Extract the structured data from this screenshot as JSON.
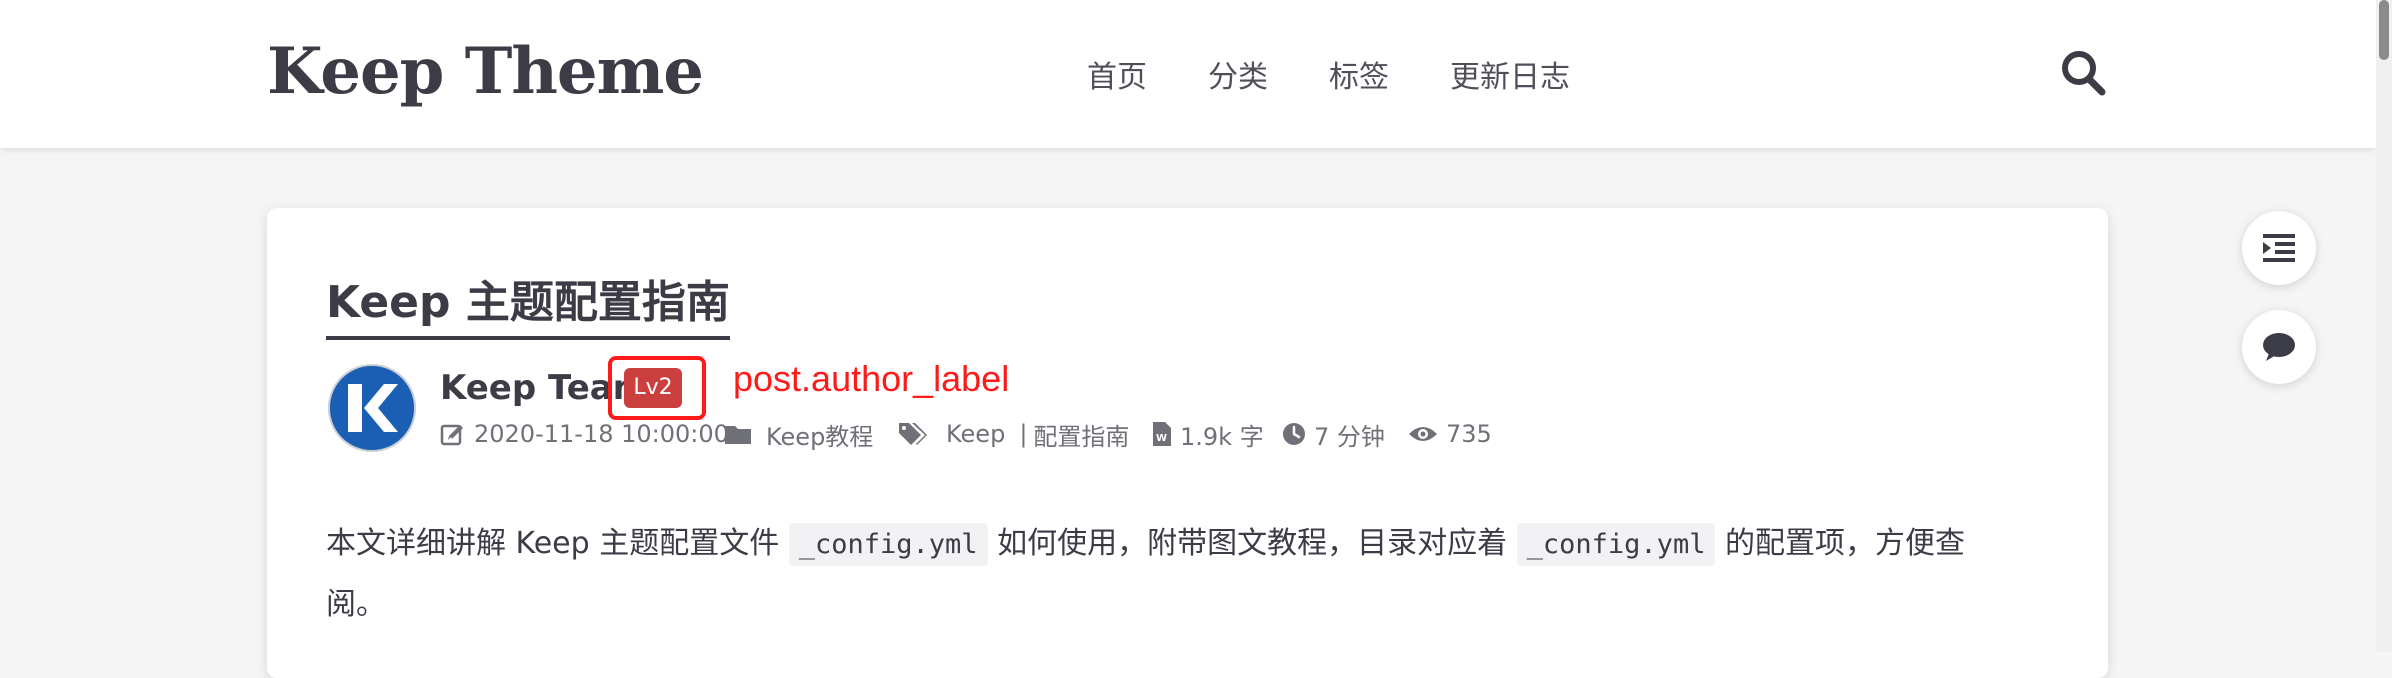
{
  "site": {
    "title": "Keep Theme"
  },
  "nav": {
    "items": [
      "首页",
      "分类",
      "标签",
      "更新日志"
    ],
    "search_icon": "search-icon"
  },
  "post": {
    "title": "Keep 主题配置指南",
    "author": {
      "name": "Keep Team",
      "level": "Lv2",
      "avatar_letter": "K"
    },
    "annotation": "post.author_label",
    "meta": {
      "date": "2020-11-18 10:00:00",
      "category": "Keep教程",
      "tags": [
        "Keep",
        "配置指南"
      ],
      "tag_separator": "|",
      "word_count": "1.9k 字",
      "reading_time": "7 分钟",
      "views": "735"
    },
    "excerpt": {
      "part1": "本文详细讲解 Keep 主题配置文件 ",
      "code1": "_config.yml",
      "part2": " 如何使用，附带图文教程，目录对应着 ",
      "code2": "_config.yml",
      "part3": " 的配置项，方便查阅。"
    }
  },
  "side_tools": [
    "toc-toggle-icon",
    "comment-icon"
  ],
  "colors": {
    "badge": "#cc3f3f",
    "annotation": "#ff1a1a",
    "avatar": "#1a5fb4",
    "text": "#3c3c46"
  }
}
